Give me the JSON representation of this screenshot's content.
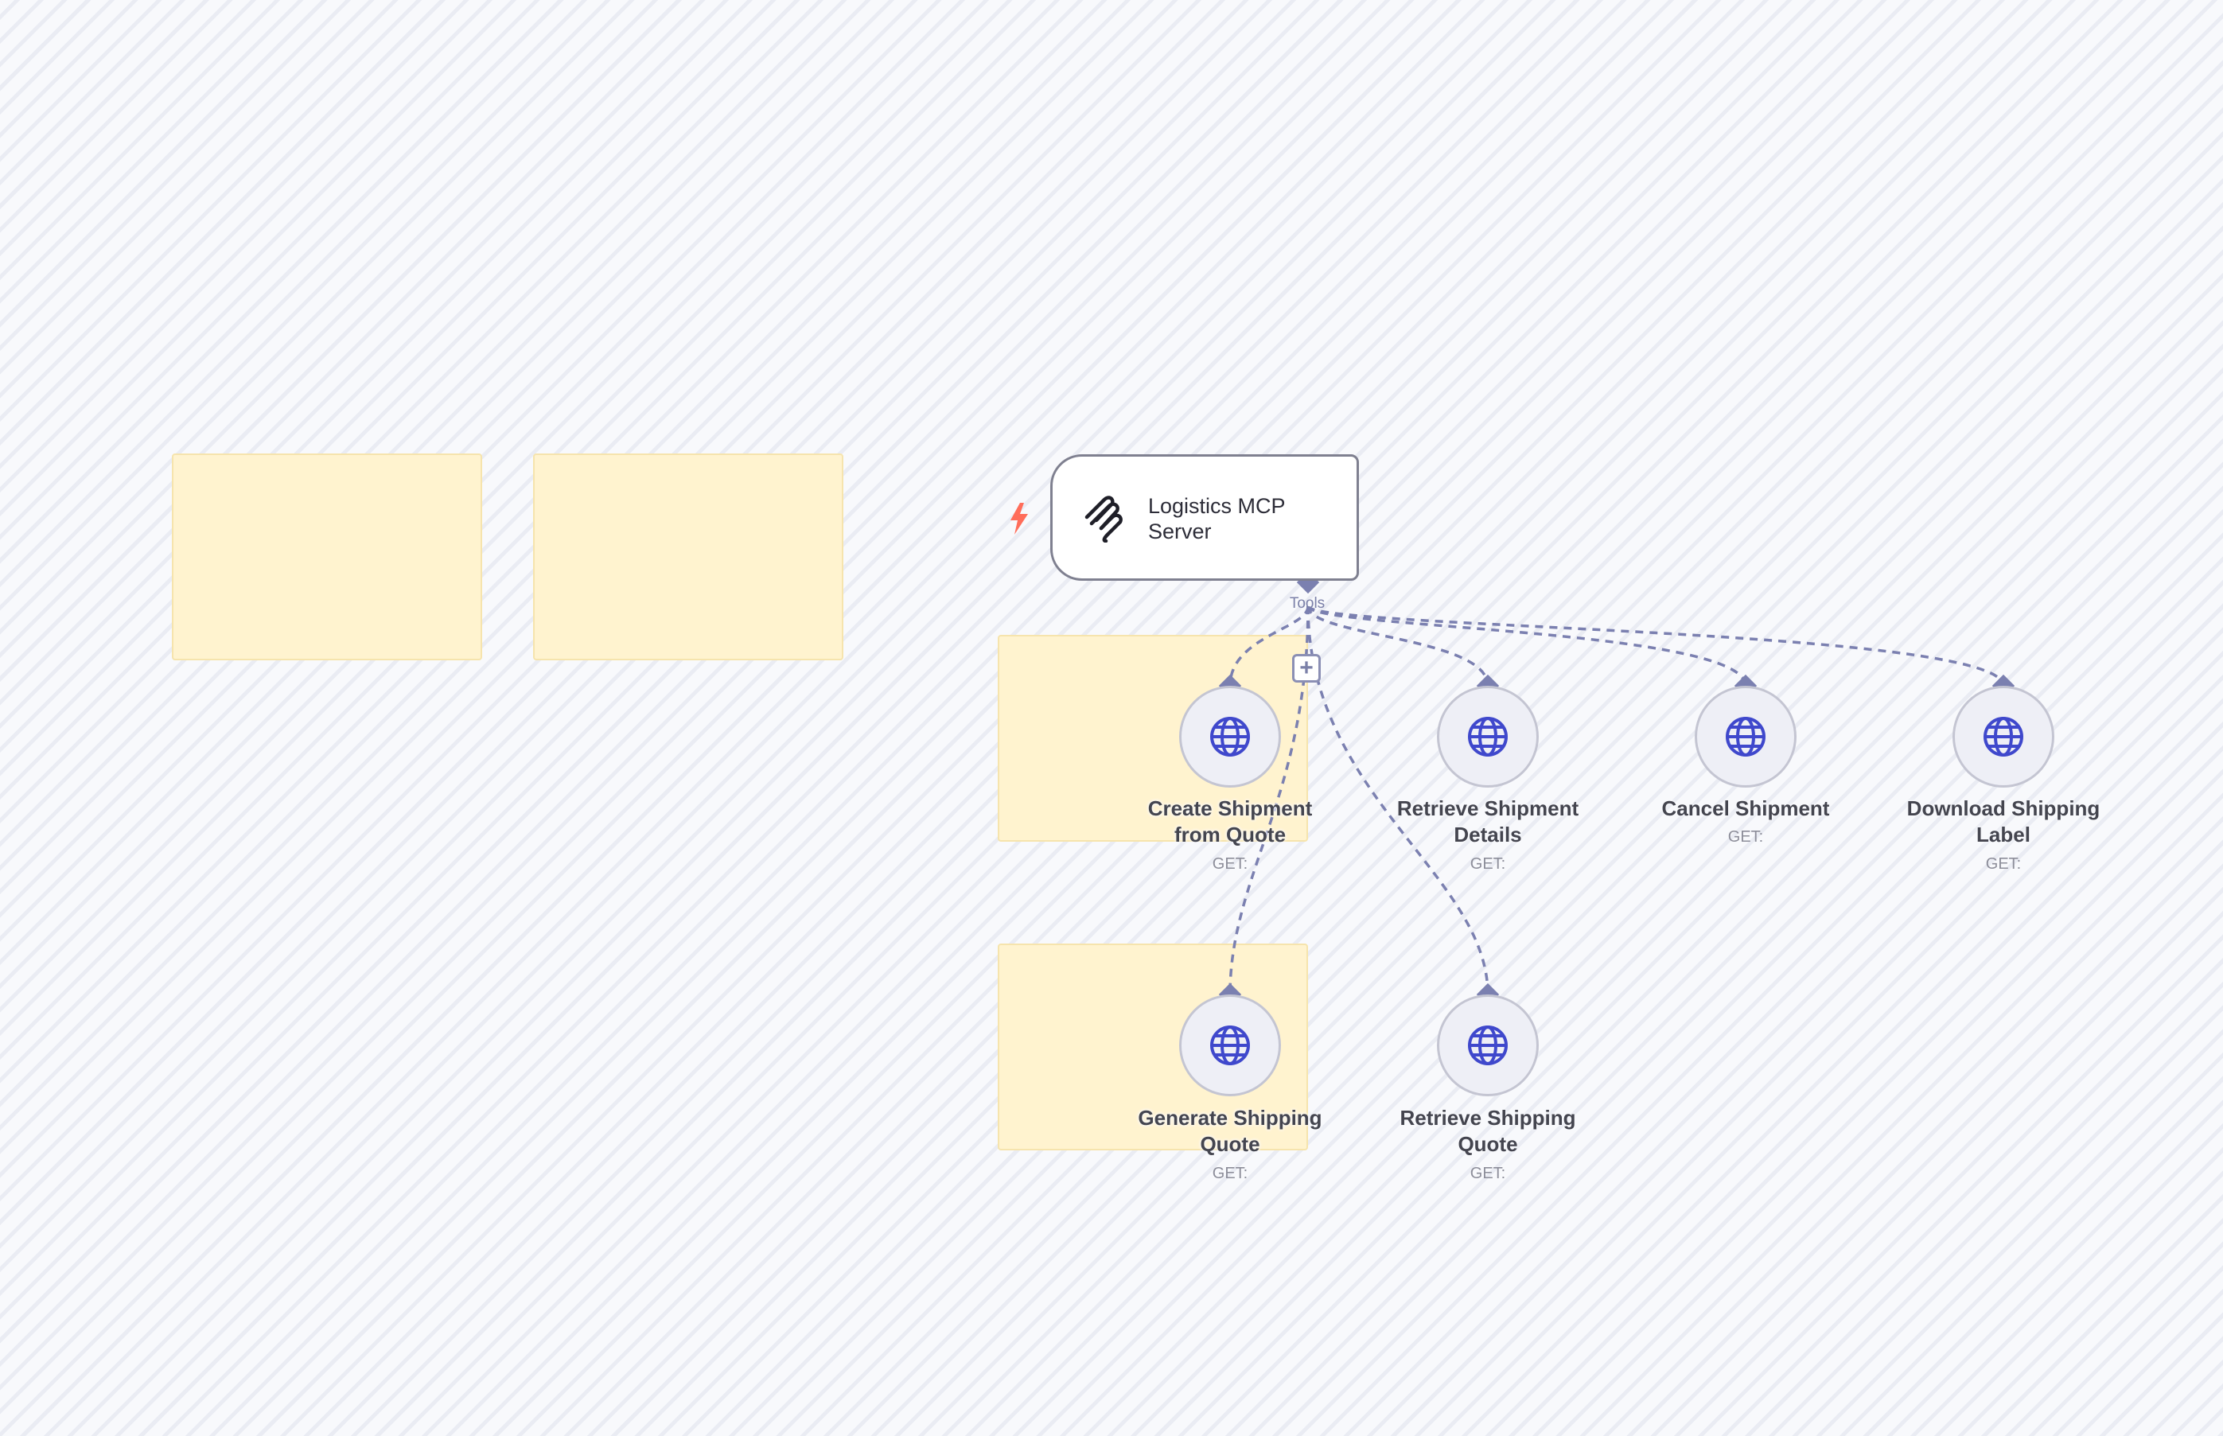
{
  "server": {
    "label": "Logistics MCP Server",
    "icon": "stack-icon"
  },
  "trigger": {
    "icon": "lightning-bolt-icon",
    "color": "#ff6d5a"
  },
  "tools_connector": {
    "label": "Tools",
    "add_icon": "plus-icon"
  },
  "tools": [
    {
      "label": "Create Shipment from Quote",
      "method": "GET:",
      "icon": "globe-icon"
    },
    {
      "label": "Retrieve Shipment Details",
      "method": "GET:",
      "icon": "globe-icon"
    },
    {
      "label": "Cancel Shipment",
      "method": "GET:",
      "icon": "globe-icon"
    },
    {
      "label": "Download Shipping Label",
      "method": "GET:",
      "icon": "globe-icon"
    },
    {
      "label": "Generate Shipping Quote",
      "method": "GET:",
      "icon": "globe-icon"
    },
    {
      "label": "Retrieve Shipping Quote",
      "method": "GET:",
      "icon": "globe-icon"
    }
  ],
  "colors": {
    "edge": "#7b80b0",
    "sticky_fill": "#fff3cf",
    "globe": "#3f48cc"
  }
}
